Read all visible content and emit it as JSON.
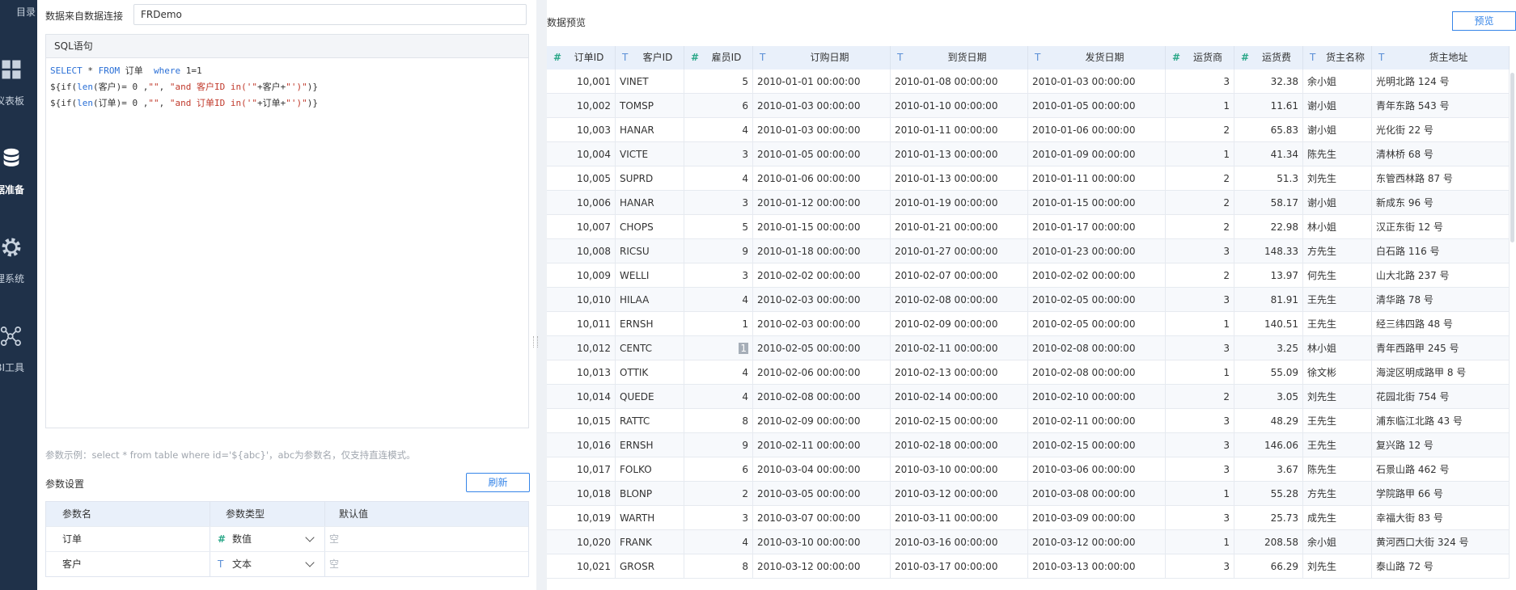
{
  "sidebar": {
    "items": [
      {
        "label": "目录",
        "icon": "catalog-icon"
      },
      {
        "label": "仪表板",
        "icon": "dashboard-icon"
      },
      {
        "label": "数据准备",
        "icon": "database-icon"
      },
      {
        "label": "管理系统",
        "icon": "gear-icon"
      },
      {
        "label": "BI工具",
        "icon": "network-icon"
      }
    ]
  },
  "left": {
    "conn_label": "数据来自数据连接",
    "conn_value": "FRDemo",
    "sql_title": "SQL语句",
    "sql": {
      "line1_kw1": "SELECT",
      "line1_mid": " * ",
      "line1_kw2": "FROM",
      "line1_table": " 订单  ",
      "line1_kw3": "where",
      "line1_end": " 1=1",
      "line2_a": "${if(",
      "line2_fn": "len",
      "line2_b": "(客户)= 0 ,",
      "line2_s1": "\"\"",
      "line2_c": ", ",
      "line2_s2": "\"and 客户ID in('\"",
      "line2_d": "+客户+",
      "line2_s3": "\"')\"",
      "line2_e": ")}",
      "line3_a": "${if(",
      "line3_fn": "len",
      "line3_b": "(订单)= 0 ,",
      "line3_s1": "\"\"",
      "line3_c": ", ",
      "line3_s2": "\"and 订单ID in('\"",
      "line3_d": "+订单+",
      "line3_s3": "\"')\"",
      "line3_e": ")}"
    },
    "hint": "参数示例：select * from table where id='${abc}'，abc为参数名，仅支持直连模式。",
    "param_title": "参数设置",
    "refresh_label": "刷新",
    "param_headers": [
      "参数名",
      "参数类型",
      "默认值"
    ],
    "params": [
      {
        "name": "订单",
        "type_icon": "#",
        "type": "数值",
        "default": "空"
      },
      {
        "name": "客户",
        "type_icon": "T",
        "type": "文本",
        "default": "空"
      }
    ]
  },
  "right": {
    "title": "数据预览",
    "preview_label": "预览",
    "columns": [
      {
        "name": "订单ID",
        "icon": "#"
      },
      {
        "name": "客户ID",
        "icon": "T"
      },
      {
        "name": "雇员ID",
        "icon": "#"
      },
      {
        "name": "订购日期",
        "icon": "T"
      },
      {
        "name": "到货日期",
        "icon": "T"
      },
      {
        "name": "发货日期",
        "icon": "T"
      },
      {
        "name": "运货商",
        "icon": "#"
      },
      {
        "name": "运货费",
        "icon": "#"
      },
      {
        "name": "货主名称",
        "icon": "T"
      },
      {
        "name": "货主地址",
        "icon": "T"
      }
    ],
    "rows": [
      [
        "10,001",
        "VINET",
        "5",
        "2010-01-01 00:00:00",
        "2010-01-08 00:00:00",
        "2010-01-03 00:00:00",
        "3",
        "32.38",
        "余小姐",
        "光明北路 124 号"
      ],
      [
        "10,002",
        "TOMSP",
        "6",
        "2010-01-03 00:00:00",
        "2010-01-10 00:00:00",
        "2010-01-05 00:00:00",
        "1",
        "11.61",
        "谢小姐",
        "青年东路 543 号"
      ],
      [
        "10,003",
        "HANAR",
        "4",
        "2010-01-03 00:00:00",
        "2010-01-11 00:00:00",
        "2010-01-06 00:00:00",
        "2",
        "65.83",
        "谢小姐",
        "光化街 22 号"
      ],
      [
        "10,004",
        "VICTE",
        "3",
        "2010-01-05 00:00:00",
        "2010-01-13 00:00:00",
        "2010-01-09 00:00:00",
        "1",
        "41.34",
        "陈先生",
        "清林桥 68 号"
      ],
      [
        "10,005",
        "SUPRD",
        "4",
        "2010-01-06 00:00:00",
        "2010-01-13 00:00:00",
        "2010-01-11 00:00:00",
        "2",
        "51.3",
        "刘先生",
        "东管西林路 87 号"
      ],
      [
        "10,006",
        "HANAR",
        "3",
        "2010-01-12 00:00:00",
        "2010-01-19 00:00:00",
        "2010-01-15 00:00:00",
        "2",
        "58.17",
        "谢小姐",
        "新成东 96 号"
      ],
      [
        "10,007",
        "CHOPS",
        "5",
        "2010-01-15 00:00:00",
        "2010-01-21 00:00:00",
        "2010-01-17 00:00:00",
        "2",
        "22.98",
        "林小姐",
        "汉正东街 12 号"
      ],
      [
        "10,008",
        "RICSU",
        "9",
        "2010-01-18 00:00:00",
        "2010-01-27 00:00:00",
        "2010-01-23 00:00:00",
        "3",
        "148.33",
        "方先生",
        "白石路 116 号"
      ],
      [
        "10,009",
        "WELLI",
        "3",
        "2010-02-02 00:00:00",
        "2010-02-07 00:00:00",
        "2010-02-02 00:00:00",
        "2",
        "13.97",
        "何先生",
        "山大北路 237 号"
      ],
      [
        "10,010",
        "HILAA",
        "4",
        "2010-02-03 00:00:00",
        "2010-02-08 00:00:00",
        "2010-02-05 00:00:00",
        "3",
        "81.91",
        "王先生",
        "清华路 78 号"
      ],
      [
        "10,011",
        "ERNSH",
        "1",
        "2010-02-03 00:00:00",
        "2010-02-09 00:00:00",
        "2010-02-05 00:00:00",
        "1",
        "140.51",
        "王先生",
        "经三纬四路 48 号"
      ],
      [
        "10,012",
        "CENTC",
        "1",
        "2010-02-05 00:00:00",
        "2010-02-11 00:00:00",
        "2010-02-08 00:00:00",
        "3",
        "3.25",
        "林小姐",
        "青年西路甲 245 号"
      ],
      [
        "10,013",
        "OTTIK",
        "4",
        "2010-02-06 00:00:00",
        "2010-02-13 00:00:00",
        "2010-02-08 00:00:00",
        "1",
        "55.09",
        "徐文彬",
        "海淀区明成路甲 8 号"
      ],
      [
        "10,014",
        "QUEDE",
        "4",
        "2010-02-08 00:00:00",
        "2010-02-14 00:00:00",
        "2010-02-10 00:00:00",
        "2",
        "3.05",
        "刘先生",
        "花园北街 754 号"
      ],
      [
        "10,015",
        "RATTC",
        "8",
        "2010-02-09 00:00:00",
        "2010-02-15 00:00:00",
        "2010-02-11 00:00:00",
        "3",
        "48.29",
        "王先生",
        "浦东临江北路 43 号"
      ],
      [
        "10,016",
        "ERNSH",
        "9",
        "2010-02-11 00:00:00",
        "2010-02-18 00:00:00",
        "2010-02-15 00:00:00",
        "3",
        "146.06",
        "王先生",
        "复兴路 12 号"
      ],
      [
        "10,017",
        "FOLKO",
        "6",
        "2010-03-04 00:00:00",
        "2010-03-10 00:00:00",
        "2010-03-06 00:00:00",
        "3",
        "3.67",
        "陈先生",
        "石景山路 462 号"
      ],
      [
        "10,018",
        "BLONP",
        "2",
        "2010-03-05 00:00:00",
        "2010-03-12 00:00:00",
        "2010-03-08 00:00:00",
        "1",
        "55.28",
        "方先生",
        "学院路甲 66 号"
      ],
      [
        "10,019",
        "WARTH",
        "3",
        "2010-03-07 00:00:00",
        "2010-03-11 00:00:00",
        "2010-03-09 00:00:00",
        "3",
        "25.73",
        "成先生",
        "幸福大街 83 号"
      ],
      [
        "10,020",
        "FRANK",
        "4",
        "2010-03-10 00:00:00",
        "2010-03-16 00:00:00",
        "2010-03-12 00:00:00",
        "1",
        "208.58",
        "余小姐",
        "黄河西口大街 324 号"
      ],
      [
        "10,021",
        "GROSR",
        "8",
        "2010-03-12 00:00:00",
        "2010-03-17 00:00:00",
        "2010-03-13 00:00:00",
        "3",
        "66.29",
        "刘先生",
        "泰山路 72 号"
      ]
    ],
    "colors": {
      "accent": "#3685e8",
      "num_icon": "#2aa788",
      "text_icon": "#5b8fd6",
      "header_bg": "#e9f0fa"
    }
  }
}
